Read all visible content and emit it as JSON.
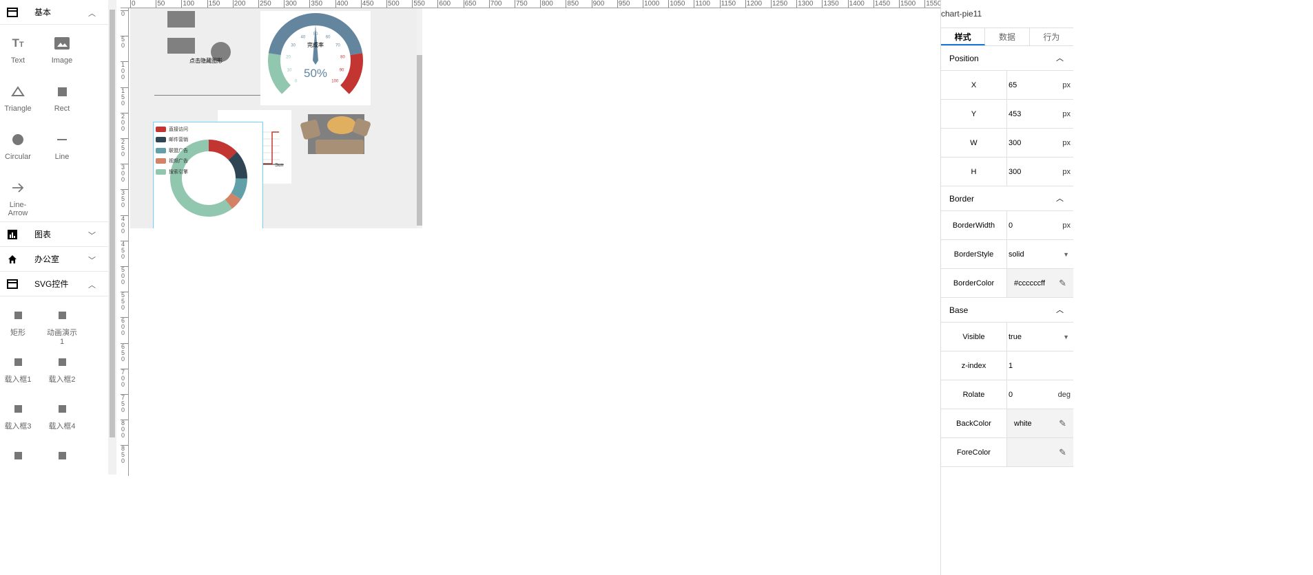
{
  "sidebar": {
    "sections": [
      {
        "label": "基本",
        "icon": "card-icon",
        "expanded": true
      },
      {
        "label": "图表",
        "icon": "bar-chart-icon",
        "expanded": false
      },
      {
        "label": "办公室",
        "icon": "home-icon",
        "expanded": false
      },
      {
        "label": "SVG控件",
        "icon": "card-icon",
        "expanded": true
      }
    ],
    "basic_items": [
      {
        "label": "Text",
        "icon": "text-format-icon"
      },
      {
        "label": "Image",
        "icon": "image-icon"
      },
      {
        "label": "Triangle",
        "icon": "triangle-icon"
      },
      {
        "label": "Rect",
        "icon": "square-icon"
      },
      {
        "label": "Circular",
        "icon": "circle-icon"
      },
      {
        "label": "Line",
        "icon": "line-icon"
      },
      {
        "label": "Line-Arrow",
        "icon": "arrow-right-icon"
      }
    ],
    "svg_items": [
      {
        "label": "矩形"
      },
      {
        "label": "动画演示1"
      },
      {
        "label": "载入框1"
      },
      {
        "label": "载入框2"
      },
      {
        "label": "载入框3"
      },
      {
        "label": "载入框4"
      },
      {
        "label": ""
      },
      {
        "label": ""
      }
    ]
  },
  "ruler": {
    "h": [
      "0",
      "50",
      "100",
      "150",
      "200",
      "250",
      "300",
      "350",
      "400",
      "450",
      "500",
      "550",
      "600",
      "650",
      "700",
      "750",
      "800",
      "850",
      "900",
      "950",
      "1000",
      "1050",
      "1100",
      "1150",
      "1200",
      "1250",
      "1300",
      "1350",
      "1400",
      "1450",
      "1500",
      "1550"
    ],
    "v": [
      "0",
      "50",
      "100",
      "150",
      "200",
      "250",
      "300",
      "350",
      "400",
      "450",
      "500",
      "550",
      "600",
      "650",
      "700",
      "750",
      "800",
      "850"
    ]
  },
  "canvas": {
    "hide_text": "点击隐藏图形",
    "gauge": {
      "title": "完成率",
      "value": 50,
      "display": "50%",
      "ticks": [
        "0",
        "10",
        "20",
        "30",
        "40",
        "50",
        "60",
        "70",
        "80",
        "90",
        "100"
      ],
      "colors": [
        "#91c7ae",
        "#63869e",
        "#c23531"
      ]
    },
    "pie": {
      "legend": [
        "直接访问",
        "邮件营销",
        "联盟广告",
        "视频广告",
        "搜索引擎"
      ],
      "values": [
        335,
        310,
        234,
        135,
        1548
      ],
      "colors": [
        "#c23531",
        "#2f4554",
        "#61a0a8",
        "#d48265",
        "#91c7ae"
      ]
    },
    "line_axis_label": "Sun"
  },
  "panel": {
    "title": "chart-pie11",
    "tabs": [
      "样式",
      "数据",
      "行为"
    ],
    "active_tab": "样式",
    "groups": {
      "position": "Position",
      "border": "Border",
      "base": "Base"
    },
    "x": {
      "label": "X",
      "value": "65",
      "unit": "px"
    },
    "y": {
      "label": "Y",
      "value": "453",
      "unit": "px"
    },
    "w": {
      "label": "W",
      "value": "300",
      "unit": "px"
    },
    "h": {
      "label": "H",
      "value": "300",
      "unit": "px"
    },
    "border_width": {
      "label": "BorderWidth",
      "value": "0",
      "unit": "px"
    },
    "border_style": {
      "label": "BorderStyle",
      "value": "solid"
    },
    "border_color": {
      "label": "BorderColor",
      "value": "#ccccccff"
    },
    "visible": {
      "label": "Visible",
      "value": "true"
    },
    "zindex": {
      "label": "z-index",
      "value": "1"
    },
    "rotate": {
      "label": "Rolate",
      "value": "0",
      "unit": "deg"
    },
    "back_color": {
      "label": "BackColor",
      "value": "white"
    },
    "fore_color": {
      "label": "ForeColor",
      "value": ""
    }
  }
}
